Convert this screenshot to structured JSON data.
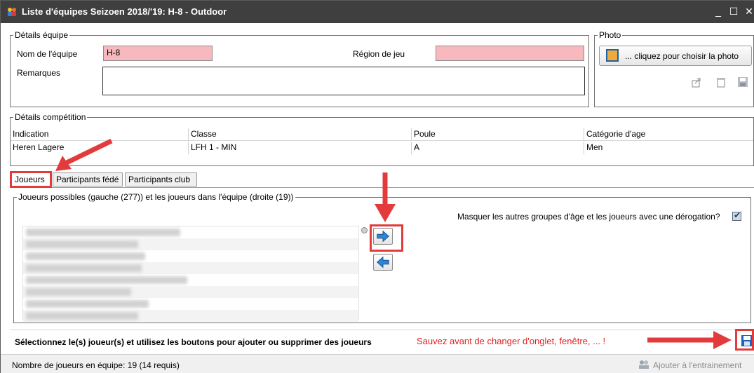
{
  "window": {
    "title": "Liste d'équipes Seizoen 2018/'19: H-8 - Outdoor",
    "minimize": "_",
    "maximize": "☐",
    "close": "✕"
  },
  "team_details": {
    "legend": "Détails équipe",
    "name_label": "Nom de l'équipe",
    "name_value": "H-8",
    "region_label": "Région de jeu",
    "region_value": "",
    "remarks_label": "Remarques",
    "remarks_value": ""
  },
  "photo": {
    "legend": "Photo",
    "choose_label": "... cliquez pour choisir la photo",
    "icons": [
      "export-icon",
      "delete-icon",
      "save-icon"
    ]
  },
  "competition": {
    "legend": "Détails compétition",
    "headers": [
      "Indication",
      "Classe",
      "Poule",
      "Catégorie d'age"
    ],
    "row": [
      "Heren Lagere",
      "LFH 1  - MIN",
      "A",
      "Men"
    ]
  },
  "tabs": [
    {
      "label": "Joueurs",
      "active": true
    },
    {
      "label": "Participants fédé",
      "active": false
    },
    {
      "label": "Participants club",
      "active": false
    }
  ],
  "players": {
    "legend": "Joueurs possibles (gauche (277)) et les joueurs dans l'équipe (droite (19))",
    "hide_label": "Masquer les autres groupes d'âge et les joueurs avec une dérogation?",
    "hide_checked": true,
    "instruction": "Sélectionnez le(s) joueur(s) et utilisez les boutons pour ajouter ou supprimer des joueurs",
    "warning": "Sauvez avant de changer d'onglet, fenêtre, ... !"
  },
  "status": {
    "count": "Nombre de joueurs en équipe: 19 (14 requis)",
    "add_training": "Ajouter à l'entrainement"
  },
  "colors": {
    "required_field": "#f7b9bd",
    "annotation": "#e33b3b",
    "titlebar": "#3f3f3f"
  }
}
